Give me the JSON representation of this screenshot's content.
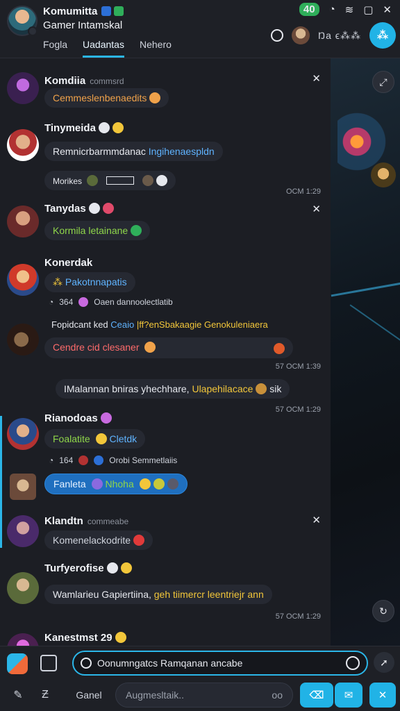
{
  "header": {
    "title": "Komumitta",
    "subtitle": "Gamer Intamskal",
    "tabs": [
      {
        "label": "Fogla",
        "active": false
      },
      {
        "label": "Uadantas",
        "active": true
      },
      {
        "label": "Nehero",
        "active": false
      }
    ],
    "battery": "40",
    "code": "Ŋa ϵ⁂⁂"
  },
  "messages": [
    {
      "name": "Komdiia",
      "name_suffix": "commsrd",
      "text": "Cemmeslenbenaedits"
    },
    {
      "name": "Tinymeida",
      "text_a": "Remnicrbarmmdanac ",
      "text_b": "Ingihenaespldn",
      "row_label": "Morikes",
      "time": "ОСМ  1:29"
    },
    {
      "name": "Tanydas",
      "text": "Kormila letainane"
    },
    {
      "name": "Konerdak",
      "text": "Pakotnnapatis",
      "row_num": "364",
      "row_text": "Oaen dannoolectlatib"
    },
    {
      "name": "",
      "line_a": "Fopidcant ked ",
      "line_b": "Ceaio",
      "line_c": " |ff?enSbakaagie ",
      "line_d": "Genokuleniaera",
      "text": "Cendre cid clesaner",
      "time": "57 ОСМ  1:39"
    },
    {
      "text_a": "IMalannan bniras yhechhare, ",
      "text_b": "Ulapehilacace",
      "text_c": " sik",
      "time": "57 ОСМ  1:29"
    },
    {
      "name": "Rianodoas",
      "text_a": "Foalatite ",
      "text_b": "Cletdk",
      "row_num": "164",
      "row_text": "Orobi Semmetlaiis",
      "blue_a": "Fanleta ",
      "blue_b": "Nhoha"
    },
    {
      "name": "Klandtn",
      "name_suffix": "commeabe",
      "text": "Komenelackodrite"
    },
    {
      "name": "Turfyerofise",
      "text_a": "Wamlarieu Gapiertiina, ",
      "text_b": "geh tiimercr leentriejr ann",
      "time": "57 ОСМ  1:29"
    },
    {
      "name": "Kanestmst 29"
    }
  ],
  "composer": {
    "input_text": "Oonumngatcs Ramqanan ancabe",
    "sub_label": "Ganel",
    "sub_placeholder": "Augmesltaik..",
    "sub_right": "oo"
  }
}
